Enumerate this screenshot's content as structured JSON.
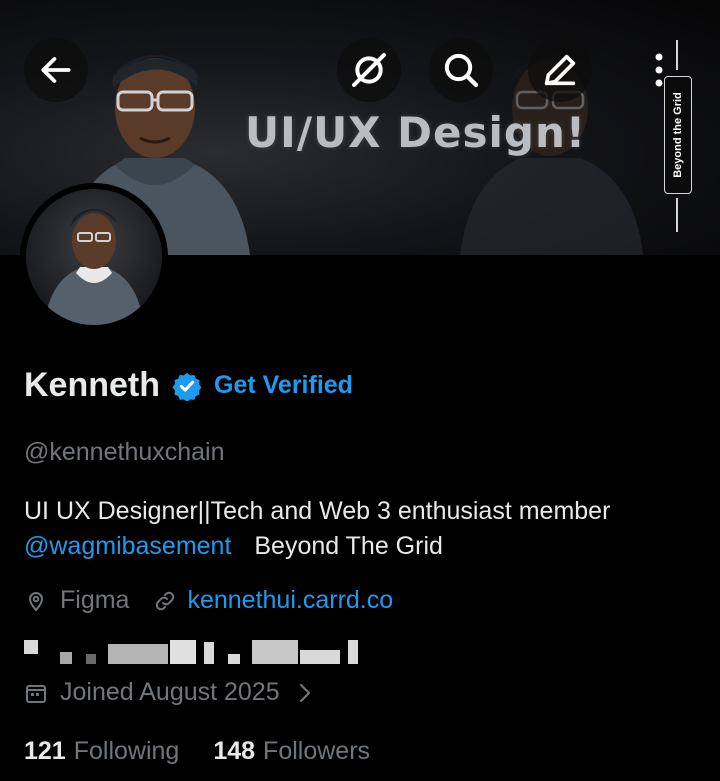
{
  "banner": {
    "title": "UI/UX Design!",
    "side_tab": "Beyond the Grid"
  },
  "toolbar": {
    "back_icon": "arrow-left-icon",
    "grok_icon": "grok-icon",
    "search_icon": "search-icon",
    "edit_icon": "pencil-icon",
    "more_icon": "more-vertical-icon"
  },
  "profile": {
    "name": "Kenneth",
    "verified_badge": "verified-badge-icon",
    "get_verified": "Get Verified",
    "handle": "@kennethuxchain",
    "bio_line1": "UI UX Designer||Tech and Web 3 enthusiast member",
    "bio_mention": "@wagmibasement",
    "bio_rest": "Beyond The Grid",
    "location": "Figma",
    "website": "kennethui.carrd.co",
    "joined": "Joined August 2025",
    "following_count": "121",
    "following_label": "Following",
    "followers_count": "148",
    "followers_label": "Followers"
  },
  "colors": {
    "background": "#000000",
    "text": "#e7e9ea",
    "muted": "#71767b",
    "accent": "#1d9bf0"
  }
}
